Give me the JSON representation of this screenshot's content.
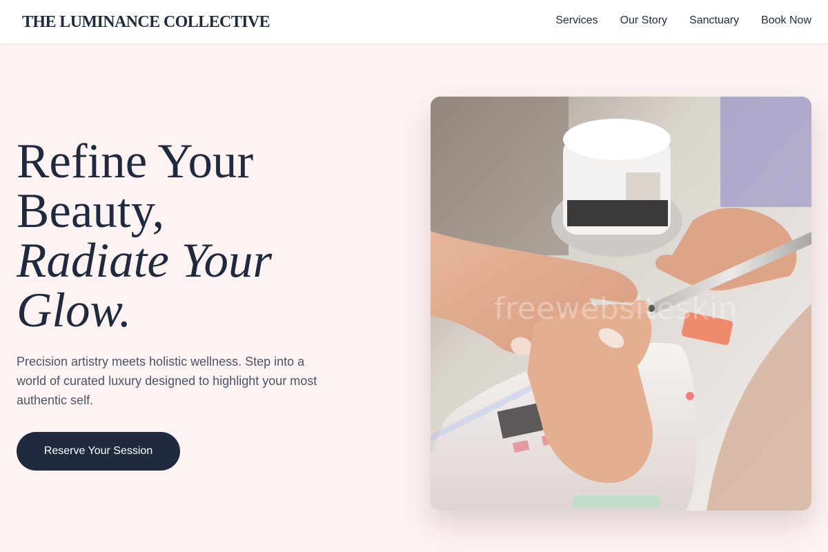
{
  "header": {
    "brand": "THE LUMINANCE COLLECTIVE",
    "nav": [
      {
        "label": "Services"
      },
      {
        "label": "Our Story"
      },
      {
        "label": "Sanctuary"
      },
      {
        "label": "Book Now"
      }
    ]
  },
  "hero": {
    "title_lines": [
      "Refine Your",
      "Beauty,",
      "Radiate Your",
      "Glow."
    ],
    "description": "Precision artistry meets holistic wellness. Step into a world of curated luxury designed to highlight your most authentic self.",
    "cta_label": "Reserve Your Session",
    "image": {
      "subject": "manicure-photo",
      "watermark": "freewebsiteskin"
    }
  },
  "colors": {
    "background": "#fdf3f2",
    "header_bg": "#ffffff",
    "primary": "#1f2a3e",
    "body_text": "#4a5468"
  }
}
